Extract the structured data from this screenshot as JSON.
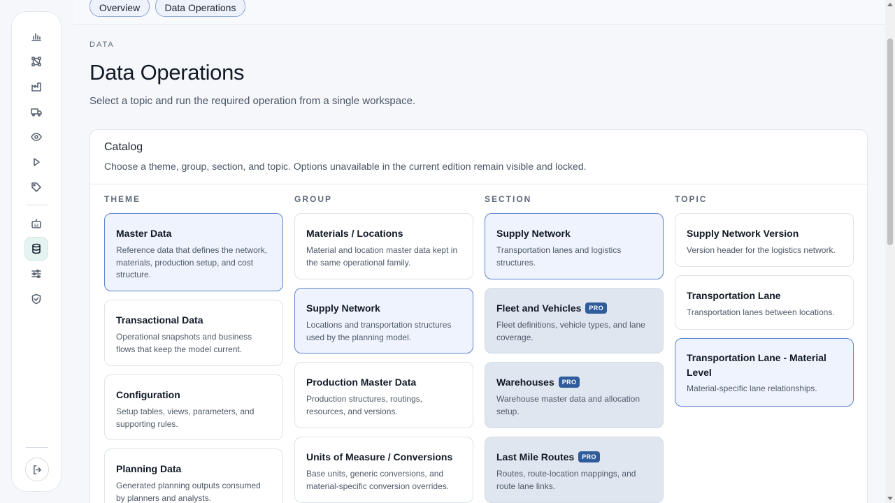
{
  "sidebar": {
    "items": [
      {
        "icon": "chart-icon"
      },
      {
        "icon": "network-icon"
      },
      {
        "icon": "factory-icon"
      },
      {
        "icon": "truck-icon"
      },
      {
        "icon": "eye-icon"
      },
      {
        "icon": "play-icon"
      },
      {
        "icon": "tag-icon"
      },
      {
        "icon": "bot-icon"
      },
      {
        "icon": "database-icon",
        "active": true
      },
      {
        "icon": "sliders-icon"
      },
      {
        "icon": "shield-check-icon"
      }
    ],
    "logout_icon": "logout-icon"
  },
  "tabs": [
    {
      "label": "Overview"
    },
    {
      "label": "Data Operations"
    }
  ],
  "header": {
    "eyebrow": "DATA",
    "title": "Data Operations",
    "subtitle": "Select a topic and run the required operation from a single workspace."
  },
  "catalog": {
    "title": "Catalog",
    "description": "Choose a theme, group, section, and topic. Options unavailable in the current edition remain visible and locked.",
    "pro_label": "PRO",
    "columns": [
      {
        "label": "THEME",
        "cards": [
          {
            "title": "Master Data",
            "desc": "Reference data that defines the network, materials, production setup, and cost structure.",
            "state": "selected"
          },
          {
            "title": "Transactional Data",
            "desc": "Operational snapshots and business flows that keep the model current.",
            "state": "default"
          },
          {
            "title": "Configuration",
            "desc": "Setup tables, views, parameters, and supporting rules.",
            "state": "default"
          },
          {
            "title": "Planning Data",
            "desc": "Generated planning outputs consumed by planners and analysts.",
            "state": "default"
          }
        ]
      },
      {
        "label": "GROUP",
        "cards": [
          {
            "title": "Materials / Locations",
            "desc": "Material and location master data kept in the same operational family.",
            "state": "default"
          },
          {
            "title": "Supply Network",
            "desc": "Locations and transportation structures used by the planning model.",
            "state": "selected"
          },
          {
            "title": "Production Master Data",
            "desc": "Production structures, routings, resources, and versions.",
            "state": "default"
          },
          {
            "title": "Units of Measure / Conversions",
            "desc": "Base units, generic conversions, and material-specific conversion overrides.",
            "state": "default"
          }
        ]
      },
      {
        "label": "SECTION",
        "cards": [
          {
            "title": "Supply Network",
            "desc": "Transportation lanes and logistics structures.",
            "state": "selected"
          },
          {
            "title": "Fleet and Vehicles",
            "desc": "Fleet definitions, vehicle types, and lane coverage.",
            "state": "locked",
            "pro": true
          },
          {
            "title": "Warehouses",
            "desc": "Warehouse master data and allocation setup.",
            "state": "locked",
            "pro": true
          },
          {
            "title": "Last Mile Routes",
            "desc": "Routes, route-location mappings, and route lane links.",
            "state": "locked",
            "pro": true
          }
        ]
      },
      {
        "label": "TOPIC",
        "cards": [
          {
            "title": "Supply Network Version",
            "desc": "Version header for the logistics network.",
            "state": "default"
          },
          {
            "title": "Transportation Lane",
            "desc": "Transportation lanes between locations.",
            "state": "default"
          },
          {
            "title": "Transportation Lane - Material Level",
            "desc": "Material-specific lane relationships.",
            "state": "selected"
          }
        ]
      }
    ]
  }
}
